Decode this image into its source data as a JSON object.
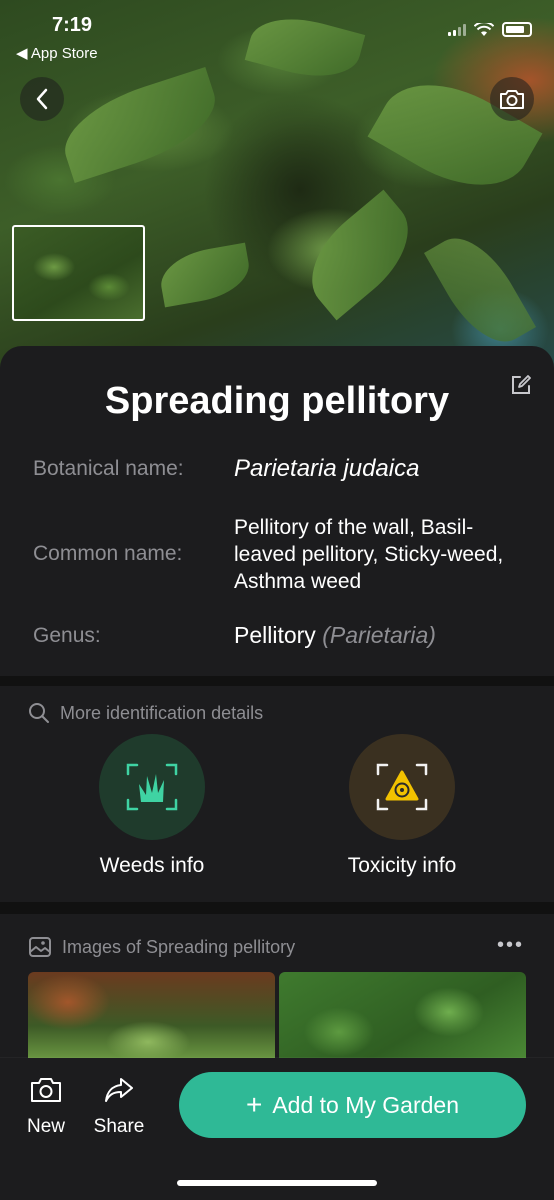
{
  "status_bar": {
    "time": "7:19",
    "back_app": "App Store"
  },
  "plant": {
    "title": "Spreading pellitory",
    "rows": {
      "botanical_label": "Botanical name:",
      "botanical_value": "Parietaria judaica",
      "common_label": "Common name:",
      "common_value": "Pellitory of the wall, Basil-leaved pellitory, Sticky-weed, Asthma weed",
      "genus_label": "Genus:",
      "genus_value": "Pellitory",
      "genus_latin": "(Parietaria)"
    }
  },
  "details": {
    "heading": "More identification details",
    "weeds_label": "Weeds info",
    "toxicity_label": "Toxicity info"
  },
  "images": {
    "heading": "Images of Spreading pellitory"
  },
  "bottom_bar": {
    "new_label": "New",
    "share_label": "Share",
    "add_label": "Add to My Garden"
  },
  "colors": {
    "accent": "#2fb996",
    "card_bg": "#1c1c1e",
    "toxicity_yellow": "#f2c200"
  }
}
